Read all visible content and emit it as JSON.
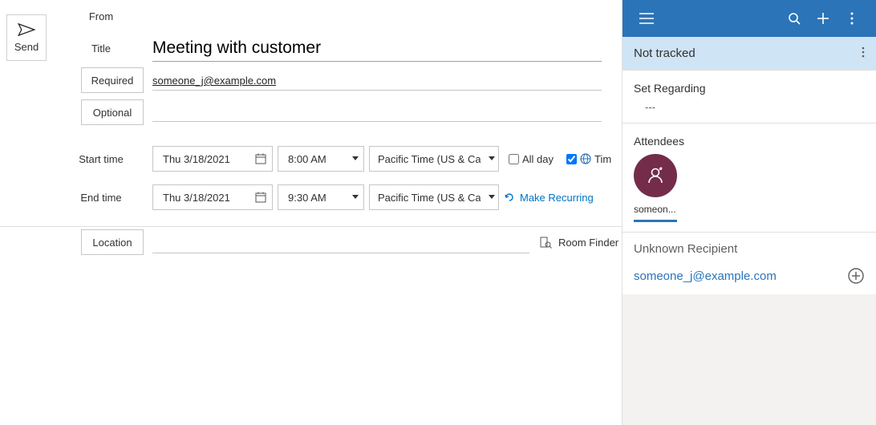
{
  "send": {
    "label": "Send"
  },
  "labels": {
    "from": "From",
    "title": "Title",
    "required": "Required",
    "optional": "Optional",
    "start": "Start time",
    "end": "End time",
    "location": "Location",
    "allday": "All day",
    "timezones": "Tim",
    "makeRecurring": "Make Recurring",
    "roomFinder": "Room Finder"
  },
  "meeting": {
    "title": "Meeting with customer",
    "required": "someone_j@example.com",
    "optional": "",
    "start": {
      "date": "Thu 3/18/2021",
      "time": "8:00 AM",
      "tz": "Pacific Time (US & Canada)"
    },
    "end": {
      "date": "Thu 3/18/2021",
      "time": "9:30 AM",
      "tz": "Pacific Time (US & Canada)"
    },
    "allday": false,
    "timezonesChecked": true,
    "location": ""
  },
  "d365": {
    "trackStatus": "Not tracked",
    "regarding": {
      "label": "Set Regarding",
      "value": "---"
    },
    "attendeesLabel": "Attendees",
    "attendee": {
      "displayShort": "someon..."
    },
    "unknown": {
      "label": "Unknown Recipient",
      "email": "someone_j@example.com"
    }
  }
}
